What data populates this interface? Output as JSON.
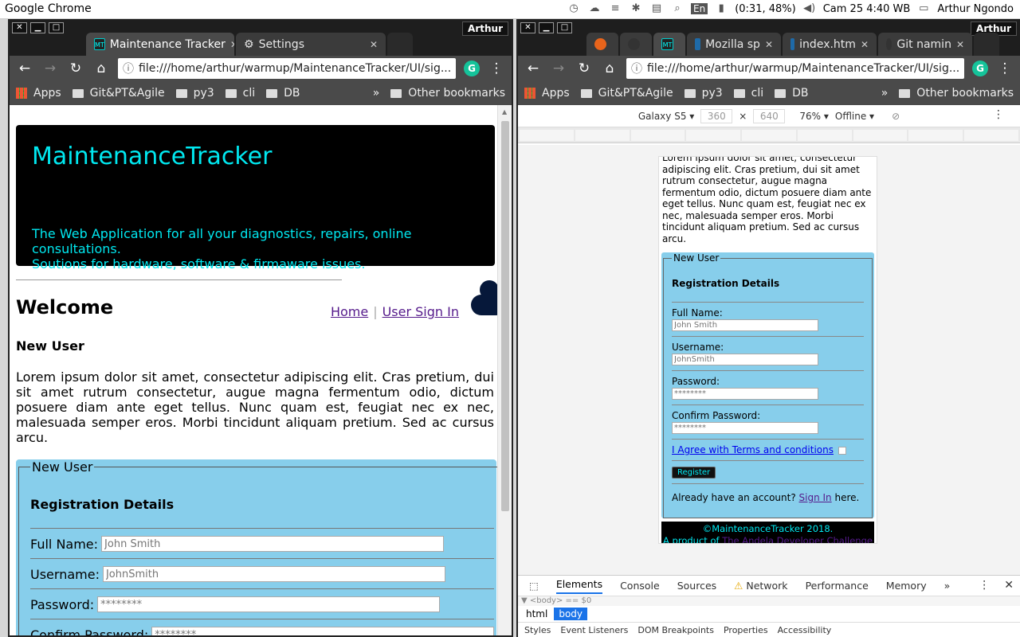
{
  "os": {
    "app_name": "Google Chrome",
    "battery": "(0:31, 48%)",
    "kb_layout": "En",
    "datetime": "Cam 25  4:40 WB",
    "user": "Arthur Ngondo"
  },
  "left_window": {
    "user_badge": "Arthur",
    "tabs": [
      {
        "label": "Maintenance Tracker",
        "favicon": "MT"
      },
      {
        "label": "Settings",
        "favicon": "gear-icon"
      }
    ],
    "url": "file:///home/arthur/warmup/MaintenanceTracker/UI/sig...",
    "bookmarks": [
      "Apps",
      "Git&PT&Agile",
      "py3",
      "cli",
      "DB"
    ],
    "other_bookmarks": "Other bookmarks",
    "chevron": "»"
  },
  "right_window": {
    "user_badge": "Arthur",
    "tabs": [
      {
        "label": "",
        "favicon": "firefox-icon"
      },
      {
        "label": "",
        "favicon": "github-icon"
      },
      {
        "label": "",
        "favicon": "MT"
      },
      {
        "label": "Mozilla sp",
        "favicon": "web-icon"
      },
      {
        "label": "index.htm",
        "favicon": "web-icon"
      },
      {
        "label": "Git namin",
        "favicon": "github-icon"
      }
    ],
    "url": "file:///home/arthur/warmup/MaintenanceTracker/UI/sig...",
    "bookmarks": [
      "Apps",
      "Git&PT&Agile",
      "py3",
      "cli",
      "DB"
    ],
    "other_bookmarks": "Other bookmarks",
    "chevron": "»"
  },
  "device_toolbar": {
    "device": "Galaxy S5 ▾",
    "width": "360",
    "times": "×",
    "height": "640",
    "zoom": "76% ▾",
    "network": "Offline ▾"
  },
  "page": {
    "brand": "MaintenanceTracker",
    "tagline_1": "The Web Application for all your diagnostics, repairs, online consultations.",
    "tagline_2": "Soutions for hardware, software & firmaware issues.",
    "welcome": "Welcome",
    "nav_home": "Home",
    "nav_sep": "|",
    "nav_signin": "User Sign In",
    "subheading": "New User",
    "lorem": "Lorem ipsum dolor sit amet, consectetur adipiscing elit. Cras pretium, dui sit amet rutrum consectetur, augue magna fermentum odio, dictum posuere diam ante eget tellus. Nunc quam est, feugiat nec ex nec, malesuada semper eros. Morbi tincidunt aliquam pretium. Sed ac cursus arcu.",
    "lorem_mobile": "Lorem ipsum dolor sit amet, consectetur adipiscing elit. Cras pretium, dui sit amet rutrum consectetur, augue magna fermentum odio, dictum posuere diam ante eget tellus. Nunc quam est, feugiat nec ex nec, malesuada semper eros. Morbi tincidunt aliquam pretium. Sed ac cursus arcu.",
    "form": {
      "legend": "New User",
      "heading": "Registration Details",
      "fullname_label": "Full Name:",
      "fullname_placeholder": "John Smith",
      "username_label": "Username:",
      "username_placeholder": "JohnSmith",
      "password_label": "Password:",
      "password_placeholder": "********",
      "confirm_label": "Confirm Password:",
      "confirm_placeholder": "********",
      "terms": "I Agree with Terms and conditions",
      "register": "Register",
      "have_account": "Already have an account?",
      "sign_in": "Sign In",
      "here": "here."
    },
    "footer_1": "©MaintenanceTracker 2018.",
    "footer_2": "A product of",
    "footer_link": "The Andela Developer Challenge"
  },
  "devtools": {
    "tabs": [
      "Elements",
      "Console",
      "Sources",
      "Network",
      "Performance",
      "Memory"
    ],
    "more": "»",
    "crumb_line": "▼ <body> == $0",
    "crumbs": [
      "html",
      "body"
    ],
    "subtabs": [
      "Styles",
      "Event Listeners",
      "DOM Breakpoints",
      "Properties",
      "Accessibility"
    ]
  }
}
